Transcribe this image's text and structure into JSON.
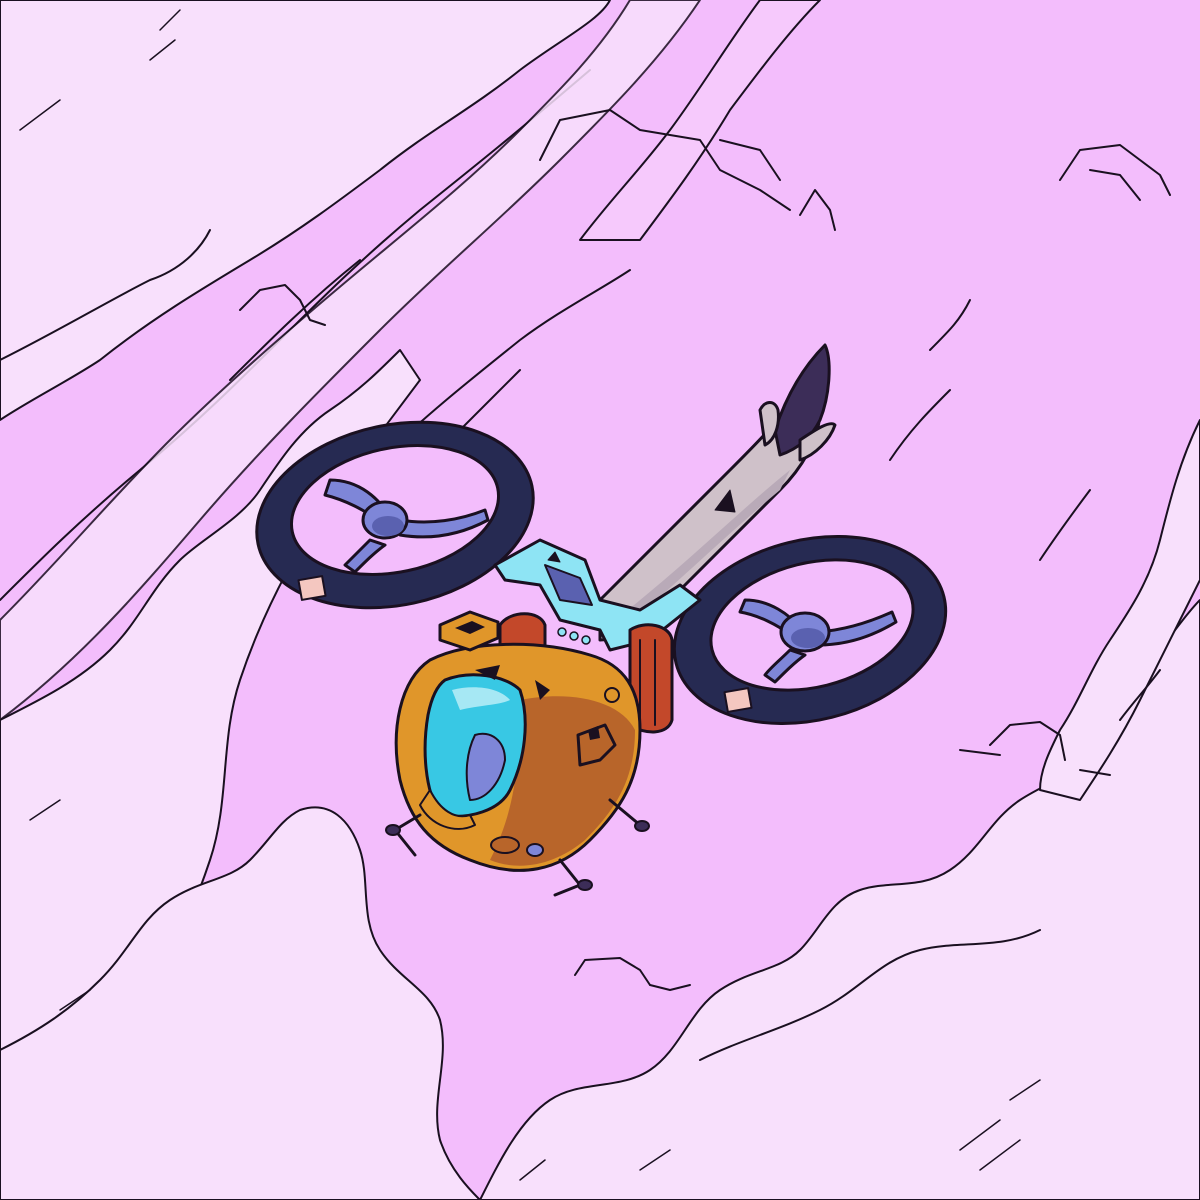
{
  "scene": {
    "kind": "illustration",
    "subject": "aircraft",
    "colors": {
      "sky": "#f3bdfc",
      "cloud_light": "#f8e0fc",
      "cloud_mid": "#f6c9fc",
      "outline": "#1a1020",
      "hull_orange": "#e0962a",
      "hull_shadow": "#b8652a",
      "canopy": "#38c8e4",
      "canopy_highlight": "#a6e8f4",
      "frame_cyan": "#8ee4f4",
      "fan_ring": "#262a52",
      "fan_hub": "#7e86d8",
      "tail_grey": "#cfc1c9",
      "tail_fin": "#3c2d58",
      "cargo_red": "#c3482a"
    },
    "icons": [
      "ducted-fan-icon",
      "landing-gear-icon",
      "mesa-rock-icon"
    ]
  }
}
